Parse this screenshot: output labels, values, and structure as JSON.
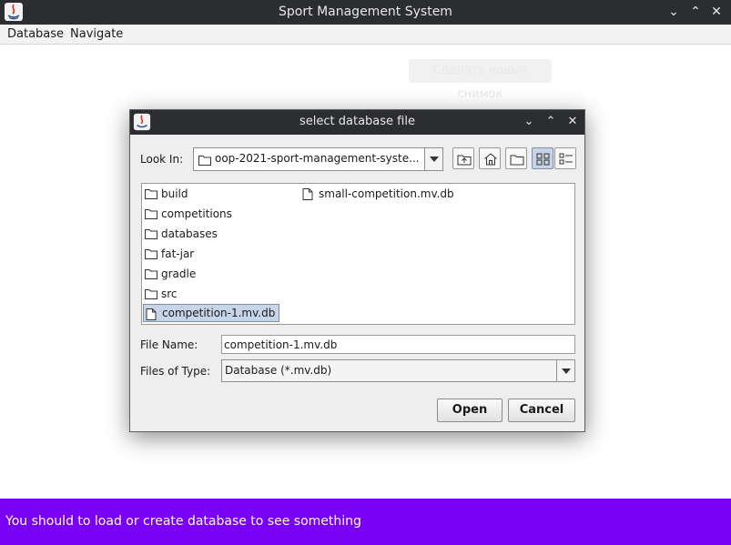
{
  "window": {
    "title": "Sport Management System",
    "controls": [
      "minimize",
      "maximize",
      "close"
    ]
  },
  "menubar": {
    "items": [
      "Database",
      "Navigate"
    ]
  },
  "workspace": {
    "ghost_button": "Сделать новый снимок"
  },
  "status_bar": {
    "message": "You should to load or create database to see something",
    "color": "#7a00f5"
  },
  "dialog": {
    "title": "select database file",
    "look_in_label": "Look In:",
    "look_in_value": "oop-2021-sport-management-syste...",
    "toolbar": [
      "up-one-level",
      "home",
      "new-folder",
      "list-view",
      "details-view"
    ],
    "files": [
      {
        "name": "build",
        "type": "folder",
        "selected": false
      },
      {
        "name": "competitions",
        "type": "folder",
        "selected": false
      },
      {
        "name": "databases",
        "type": "folder",
        "selected": false
      },
      {
        "name": "fat-jar",
        "type": "folder",
        "selected": false
      },
      {
        "name": "gradle",
        "type": "folder",
        "selected": false
      },
      {
        "name": "src",
        "type": "folder",
        "selected": false
      },
      {
        "name": "competition-1.mv.db",
        "type": "file",
        "selected": true
      },
      {
        "name": "small-competition.mv.db",
        "type": "file",
        "selected": false
      }
    ],
    "file_name_label": "File Name:",
    "file_name_value": "competition-1.mv.db",
    "files_of_type_label": "Files of Type:",
    "files_of_type_value": "Database (*.mv.db)",
    "open_button": "Open",
    "cancel_button": "Cancel"
  }
}
